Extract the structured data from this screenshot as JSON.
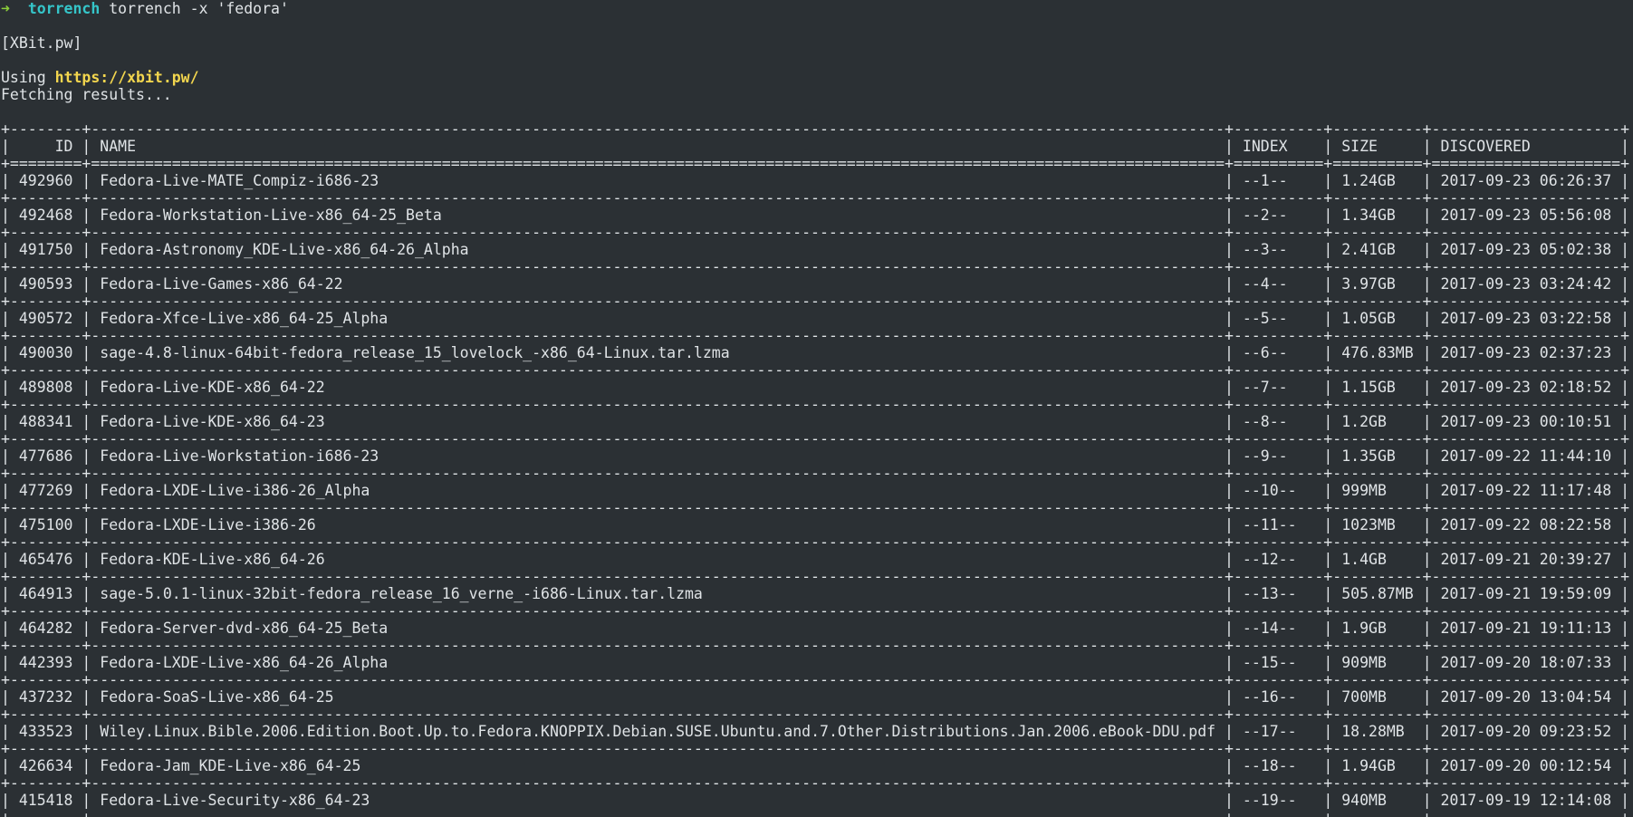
{
  "prompt": {
    "arrow": "➜",
    "directory": "torrench",
    "command": "torrench -x 'fedora'"
  },
  "site_tag": "[XBit.pw]",
  "using_prefix": "Using ",
  "using_url": "https://xbit.pw/",
  "fetching": "Fetching results...",
  "table": {
    "columns": [
      "ID",
      "NAME",
      "INDEX",
      "SIZE",
      "DISCOVERED"
    ],
    "rows": [
      {
        "id": "492960",
        "name": "Fedora-Live-MATE_Compiz-i686-23",
        "index": "--1--",
        "size": "1.24GB",
        "discovered": "2017-09-23 06:26:37"
      },
      {
        "id": "492468",
        "name": "Fedora-Workstation-Live-x86_64-25_Beta",
        "index": "--2--",
        "size": "1.34GB",
        "discovered": "2017-09-23 05:56:08"
      },
      {
        "id": "491750",
        "name": "Fedora-Astronomy_KDE-Live-x86_64-26_Alpha",
        "index": "--3--",
        "size": "2.41GB",
        "discovered": "2017-09-23 05:02:38"
      },
      {
        "id": "490593",
        "name": "Fedora-Live-Games-x86_64-22",
        "index": "--4--",
        "size": "3.97GB",
        "discovered": "2017-09-23 03:24:42"
      },
      {
        "id": "490572",
        "name": "Fedora-Xfce-Live-x86_64-25_Alpha",
        "index": "--5--",
        "size": "1.05GB",
        "discovered": "2017-09-23 03:22:58"
      },
      {
        "id": "490030",
        "name": "sage-4.8-linux-64bit-fedora_release_15_lovelock_-x86_64-Linux.tar.lzma",
        "index": "--6--",
        "size": "476.83MB",
        "discovered": "2017-09-23 02:37:23"
      },
      {
        "id": "489808",
        "name": "Fedora-Live-KDE-x86_64-22",
        "index": "--7--",
        "size": "1.15GB",
        "discovered": "2017-09-23 02:18:52"
      },
      {
        "id": "488341",
        "name": "Fedora-Live-KDE-x86_64-23",
        "index": "--8--",
        "size": "1.2GB",
        "discovered": "2017-09-23 00:10:51"
      },
      {
        "id": "477686",
        "name": "Fedora-Live-Workstation-i686-23",
        "index": "--9--",
        "size": "1.35GB",
        "discovered": "2017-09-22 11:44:10"
      },
      {
        "id": "477269",
        "name": "Fedora-LXDE-Live-i386-26_Alpha",
        "index": "--10--",
        "size": "999MB",
        "discovered": "2017-09-22 11:17:48"
      },
      {
        "id": "475100",
        "name": "Fedora-LXDE-Live-i386-26",
        "index": "--11--",
        "size": "1023MB",
        "discovered": "2017-09-22 08:22:58"
      },
      {
        "id": "465476",
        "name": "Fedora-KDE-Live-x86_64-26",
        "index": "--12--",
        "size": "1.4GB",
        "discovered": "2017-09-21 20:39:27"
      },
      {
        "id": "464913",
        "name": "sage-5.0.1-linux-32bit-fedora_release_16_verne_-i686-Linux.tar.lzma",
        "index": "--13--",
        "size": "505.87MB",
        "discovered": "2017-09-21 19:59:09"
      },
      {
        "id": "464282",
        "name": "Fedora-Server-dvd-x86_64-25_Beta",
        "index": "--14--",
        "size": "1.9GB",
        "discovered": "2017-09-21 19:11:13"
      },
      {
        "id": "442393",
        "name": "Fedora-LXDE-Live-x86_64-26_Alpha",
        "index": "--15--",
        "size": "909MB",
        "discovered": "2017-09-20 18:07:33"
      },
      {
        "id": "437232",
        "name": "Fedora-SoaS-Live-x86_64-25",
        "index": "--16--",
        "size": "700MB",
        "discovered": "2017-09-20 13:04:54"
      },
      {
        "id": "433523",
        "name": "Wiley.Linux.Bible.2006.Edition.Boot.Up.to.Fedora.KNOPPIX.Debian.SUSE.Ubuntu.and.7.Other.Distributions.Jan.2006.eBook-DDU.pdf",
        "index": "--17--",
        "size": "18.28MB",
        "discovered": "2017-09-20 09:23:52"
      },
      {
        "id": "426634",
        "name": "Fedora-Jam_KDE-Live-x86_64-25",
        "index": "--18--",
        "size": "1.94GB",
        "discovered": "2017-09-20 00:12:54"
      },
      {
        "id": "415418",
        "name": "Fedora-Live-Security-x86_64-23",
        "index": "--19--",
        "size": "940MB",
        "discovered": "2017-09-19 12:14:08"
      }
    ]
  }
}
